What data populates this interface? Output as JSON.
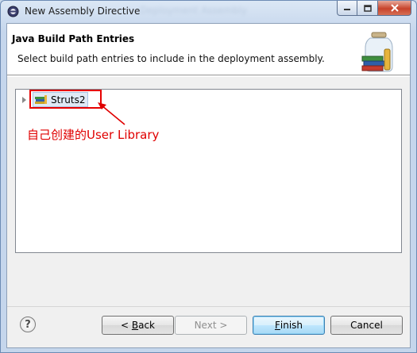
{
  "window": {
    "title": "New Assembly Directive",
    "title_ghost": "Deployment Assembly"
  },
  "header": {
    "title": "Java Build Path Entries",
    "description": "Select build path entries to include in the deployment assembly."
  },
  "tree": {
    "items": [
      {
        "label": "Struts2",
        "icon": "library-icon",
        "selected": true
      }
    ]
  },
  "annotation": {
    "text": "自己创建的User Library",
    "color": "#e00000"
  },
  "buttons": {
    "back": {
      "pre": "< ",
      "mnemonic": "B",
      "rest": "ack"
    },
    "next": "Next >",
    "finish": {
      "mnemonic": "F",
      "rest": "inish"
    },
    "cancel": "Cancel"
  }
}
